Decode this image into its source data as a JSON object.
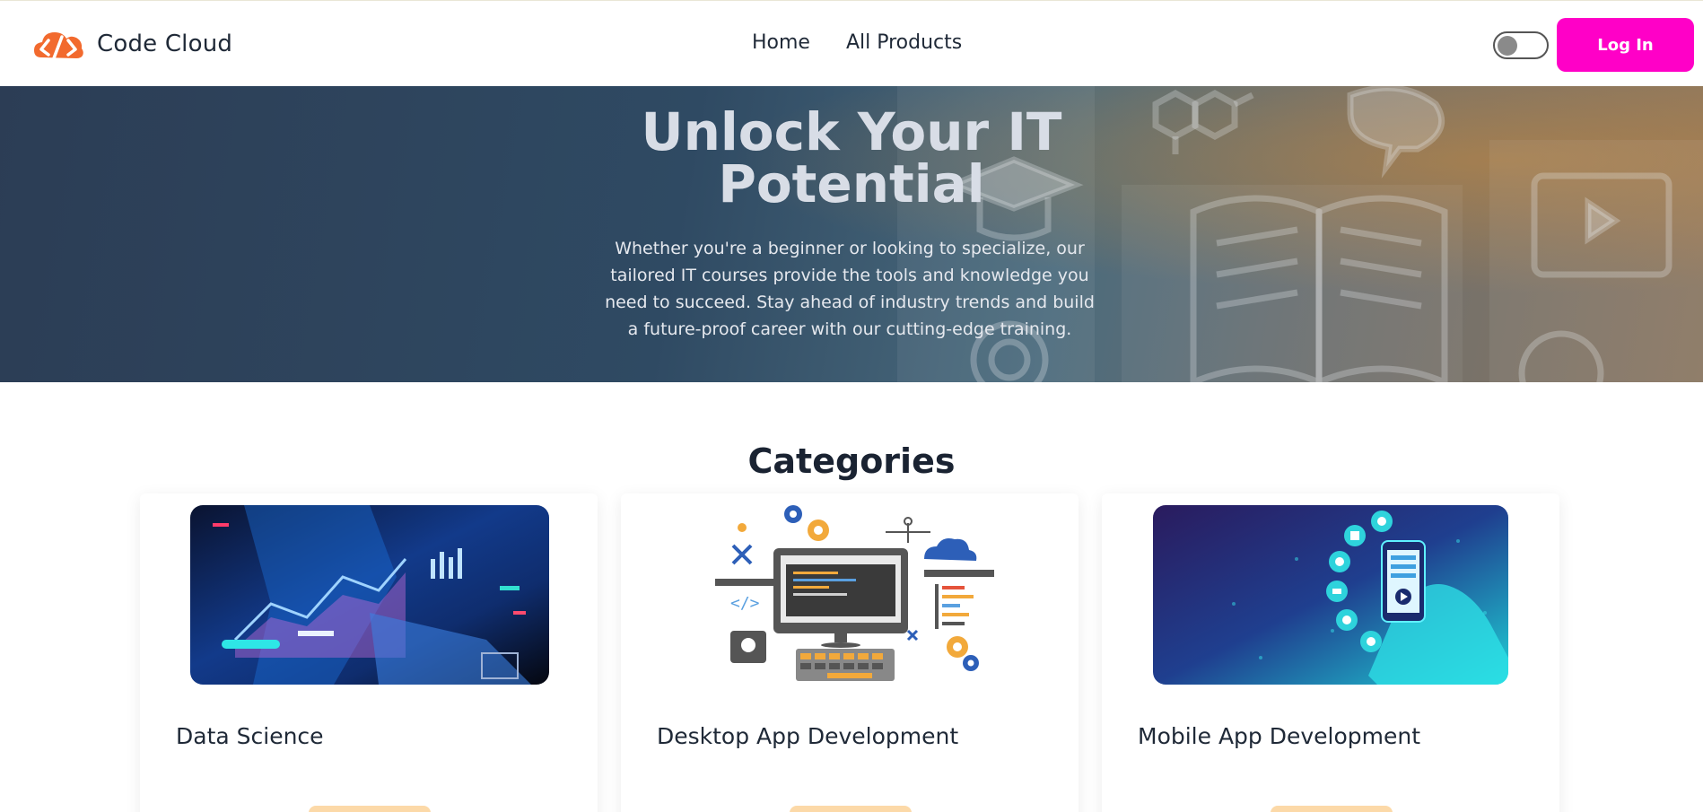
{
  "header": {
    "brand": "Code Cloud",
    "logo_icon": "cloud-code-logo-icon",
    "nav": [
      "Home",
      "All Products"
    ],
    "login_label": "Log In",
    "theme_toggle": "off"
  },
  "hero": {
    "title_line1": "Unlock Your IT",
    "title_line2": "Potential",
    "text": "Whether you're a beginner or looking to specialize, our tailored IT courses provide the tools and knowledge you need to succeed. Stay ahead of industry trends and build a future-proof career with our cutting-edge training."
  },
  "categories": {
    "title": "Categories",
    "items": [
      {
        "label": "Data Science"
      },
      {
        "label": "Desktop App Development"
      },
      {
        "label": "Mobile App Development"
      }
    ]
  },
  "colors": {
    "accent": "#ff00c7",
    "logo": "#f26a2e",
    "button_secondary": "#fcd9a8"
  }
}
